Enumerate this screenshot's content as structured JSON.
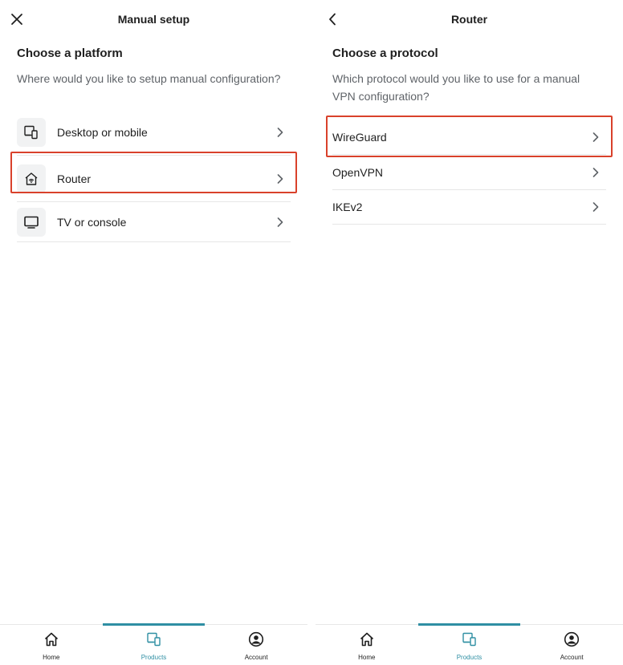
{
  "left_screen": {
    "header": {
      "title": "Manual setup",
      "close_icon": "close-icon"
    },
    "heading": "Choose a platform",
    "subtitle": "Where would you like to setup manual configuration?",
    "options": [
      {
        "label": "Desktop or mobile",
        "icon": "devices-icon"
      },
      {
        "label": "Router",
        "icon": "router-home-icon",
        "highlighted": true
      },
      {
        "label": "TV or console",
        "icon": "tv-icon"
      }
    ],
    "bottom_nav": [
      {
        "label": "Home",
        "icon": "home-icon"
      },
      {
        "label": "Products",
        "icon": "devices-icon",
        "active": true
      },
      {
        "label": "Account",
        "icon": "account-icon"
      }
    ]
  },
  "right_screen": {
    "header": {
      "title": "Router",
      "back_icon": "back-chevron-icon"
    },
    "heading": "Choose a protocol",
    "subtitle": "Which protocol would you like to use for a manual VPN configuration?",
    "options": [
      {
        "label": "WireGuard",
        "highlighted": true
      },
      {
        "label": "OpenVPN"
      },
      {
        "label": "IKEv2"
      }
    ],
    "bottom_nav": [
      {
        "label": "Home",
        "icon": "home-icon"
      },
      {
        "label": "Products",
        "icon": "devices-icon",
        "active": true
      },
      {
        "label": "Account",
        "icon": "account-icon"
      }
    ]
  },
  "colors": {
    "highlight": "#d9412b",
    "accent": "#2f8fa3",
    "text": "#1f1f1f",
    "muted": "#5f6368",
    "icon_bg": "#f1f2f3",
    "divider": "#e6e6e6"
  }
}
